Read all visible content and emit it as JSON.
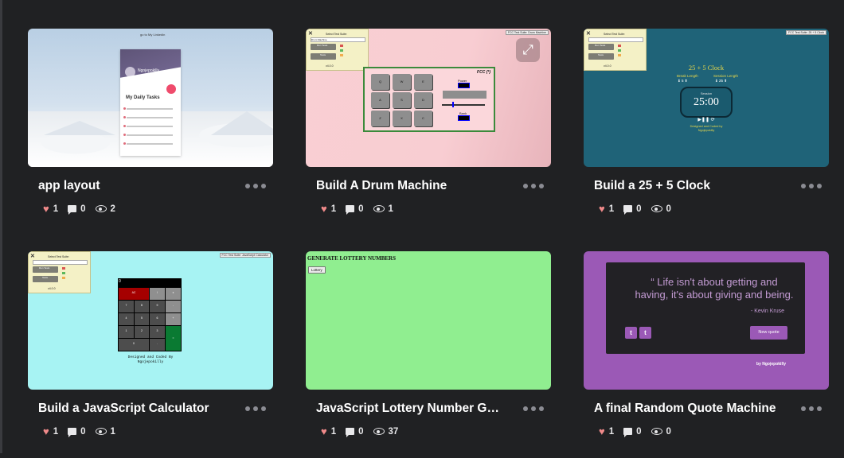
{
  "cards": [
    {
      "title": "app layout",
      "likes": "1",
      "comments": "0",
      "views": "2",
      "preview": {
        "linkedin": "go to My Linkedin",
        "phone_name": "Ngojepokilly",
        "tasks_title": "My Daily Tasks"
      }
    },
    {
      "title": "Build A Drum Machine",
      "likes": "1",
      "comments": "0",
      "views": "1",
      "preview": {
        "suite_title": "Select Test Suite:",
        "suite_option": "Drum Machine",
        "run_tests": "Run Tests",
        "tests": "Tests",
        "version": "v4.0.0",
        "fcc_tag": "FCC Test Suite: Drum Machine",
        "brand": "FCC (*)",
        "power_label": "Power",
        "bank_label": "Bank",
        "keys": [
          "Q",
          "W",
          "E",
          "A",
          "S",
          "D",
          "Z",
          "X",
          "C"
        ]
      }
    },
    {
      "title": "Build a 25 + 5 Clock",
      "likes": "1",
      "comments": "0",
      "views": "0",
      "preview": {
        "heading": "25 + 5 Clock",
        "break_label": "Break Length",
        "session_label": "Session Length",
        "break_value": "5",
        "session_value": "25",
        "face_label": "Session",
        "time": "25:00",
        "fcc_tag": "FCC Test Suite: 25 + 5 Clock",
        "byline_1": "Designed and Coded by",
        "byline_2": "Ngojepokilly"
      }
    },
    {
      "title": "Build a JavaScript Calculator",
      "likes": "1",
      "comments": "0",
      "views": "1",
      "preview": {
        "display": "0",
        "fcc_tag": "FCC Test Suite: JavaScript Calculator",
        "byline_1": "Designed and Coded By",
        "byline_2": "Ngojepokilly",
        "keys": [
          "AC",
          "/",
          "x",
          "7",
          "8",
          "9",
          "-",
          "4",
          "5",
          "6",
          "+",
          "1",
          "2",
          "3",
          "=",
          "0",
          "."
        ]
      }
    },
    {
      "title": "JavaScript Lottery Number Ge...",
      "likes": "1",
      "comments": "0",
      "views": "37",
      "preview": {
        "heading": "GENERATE LOTTERY NUMBERS",
        "button": "Lottery"
      }
    },
    {
      "title": "A final Random Quote Machine",
      "likes": "1",
      "comments": "0",
      "views": "0",
      "preview": {
        "quote": "“ Life isn't about getting and having, it's about giving and being.",
        "author": "- Kevin Kruse",
        "new_quote": "New quote",
        "byline": "by Ngojepokilly"
      }
    }
  ],
  "icons": {
    "heart": "heart-icon",
    "comment": "comment-icon",
    "views": "eye-icon",
    "more": "more-options-icon",
    "expand": "expand-icon"
  },
  "colors": {
    "background": "#202123",
    "heart": "#f08a8a",
    "drum_bg": "#f9cfd3",
    "clock_bg": "#1f6378",
    "calc_bg": "#a7f3f3",
    "lottery_bg": "#90ee90",
    "quote_bg": "#9b59b6"
  }
}
